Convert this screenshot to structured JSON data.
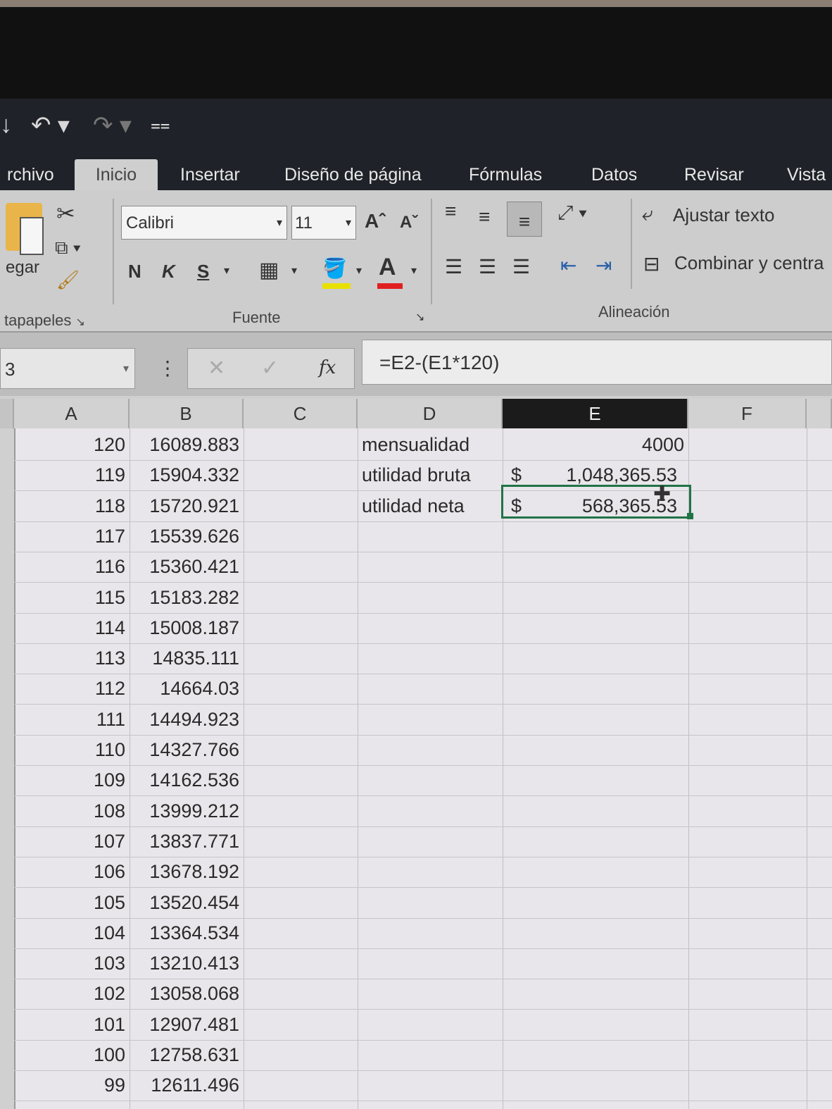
{
  "qat": {
    "save_glyph": "↓",
    "undo_glyph": "↶ ▾",
    "redo_glyph": "↷ ▾",
    "customize_glyph": "⩵"
  },
  "tabs": [
    "rchivo",
    "Inicio",
    "Insertar",
    "Diseño de página",
    "Fórmulas",
    "Datos",
    "Revisar",
    "Vista"
  ],
  "ribbon": {
    "clipboard": {
      "paste_label": "egar",
      "group_label": "tapapeles"
    },
    "font": {
      "name": "Calibri",
      "size": "11",
      "bold": "N",
      "italic": "K",
      "underline": "S",
      "grow": "Aˆ",
      "shrink": "Aˇ",
      "color_letter": "A",
      "group_label": "Fuente"
    },
    "alignment": {
      "wrap_text": "Ajustar texto",
      "merge_center": "Combinar y centra",
      "group_label": "Alineación"
    }
  },
  "formula_bar": {
    "name_box": "3",
    "formula": "=E2-(E1*120)",
    "fx": "fx",
    "more": "⋮"
  },
  "columns": [
    "A",
    "B",
    "C",
    "D",
    "E",
    "F"
  ],
  "side_cells": [
    {
      "label": "mensualidad",
      "currency": "",
      "value": "4000"
    },
    {
      "label": "utilidad bruta",
      "currency": "$",
      "value": "1,048,365.53"
    },
    {
      "label": "utilidad neta",
      "currency": "$",
      "value": "568,365.53"
    }
  ],
  "rows": [
    {
      "a": "120",
      "b": "16089.883"
    },
    {
      "a": "119",
      "b": "15904.332"
    },
    {
      "a": "118",
      "b": "15720.921"
    },
    {
      "a": "117",
      "b": "15539.626"
    },
    {
      "a": "116",
      "b": "15360.421"
    },
    {
      "a": "115",
      "b": "15183.282"
    },
    {
      "a": "114",
      "b": "15008.187"
    },
    {
      "a": "113",
      "b": "14835.111"
    },
    {
      "a": "112",
      "b": "14664.03"
    },
    {
      "a": "111",
      "b": "14494.923"
    },
    {
      "a": "110",
      "b": "14327.766"
    },
    {
      "a": "109",
      "b": "14162.536"
    },
    {
      "a": "108",
      "b": "13999.212"
    },
    {
      "a": "107",
      "b": "13837.771"
    },
    {
      "a": "106",
      "b": "13678.192"
    },
    {
      "a": "105",
      "b": "13520.454"
    },
    {
      "a": "104",
      "b": "13364.534"
    },
    {
      "a": "103",
      "b": "13210.413"
    },
    {
      "a": "102",
      "b": "13058.068"
    },
    {
      "a": "101",
      "b": "12907.481"
    },
    {
      "a": "100",
      "b": "12758.631"
    },
    {
      "a": "99",
      "b": "12611.496"
    }
  ]
}
